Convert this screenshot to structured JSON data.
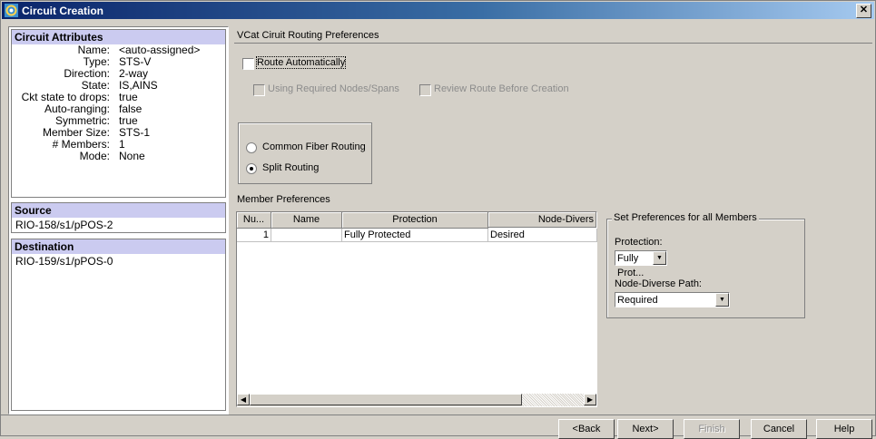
{
  "window": {
    "title": "Circuit Creation",
    "close_glyph": "✕"
  },
  "attributes": {
    "heading": "Circuit Attributes",
    "rows": [
      {
        "k": "Name:",
        "v": "<auto-assigned>"
      },
      {
        "k": "Type:",
        "v": "STS-V"
      },
      {
        "k": "Direction:",
        "v": "2-way"
      },
      {
        "k": "State:",
        "v": "IS,AINS"
      },
      {
        "k": "Ckt state to drops:",
        "v": "true"
      },
      {
        "k": "Auto-ranging:",
        "v": "false"
      },
      {
        "k": "Symmetric:",
        "v": "true"
      },
      {
        "k": "Member Size:",
        "v": "STS-1"
      },
      {
        "k": "# Members:",
        "v": "1"
      },
      {
        "k": "Mode:",
        "v": "None"
      }
    ]
  },
  "source": {
    "heading": "Source",
    "value": "RIO-158/s1/pPOS-2"
  },
  "destination": {
    "heading": "Destination",
    "value": "RIO-159/s1/pPOS-0"
  },
  "routing": {
    "header": "VCat Ciruit Routing Preferences",
    "route_automatically": "Route Automatically",
    "using_required": "Using Required Nodes/Spans",
    "review_route": "Review Route Before Creation",
    "common_fiber": "Common Fiber Routing",
    "split_routing": "Split Routing",
    "selected_routing": "split"
  },
  "members": {
    "label": "Member Preferences",
    "columns": [
      "Nu...",
      "Name",
      "Protection",
      "Node-Divers"
    ],
    "rows": [
      {
        "num": "1",
        "name": "",
        "protection": "Fully Protected",
        "node_diverse": "Desired"
      }
    ]
  },
  "set_prefs": {
    "title": "Set Preferences for all Members",
    "protection_label": "Protection:",
    "protection_value": "Fully Prot...",
    "node_diverse_label": "Node-Diverse Path:",
    "node_diverse_value": "Required"
  },
  "buttons": {
    "back": "<Back",
    "next": "Next>",
    "finish": "Finish",
    "cancel": "Cancel",
    "help": "Help"
  }
}
